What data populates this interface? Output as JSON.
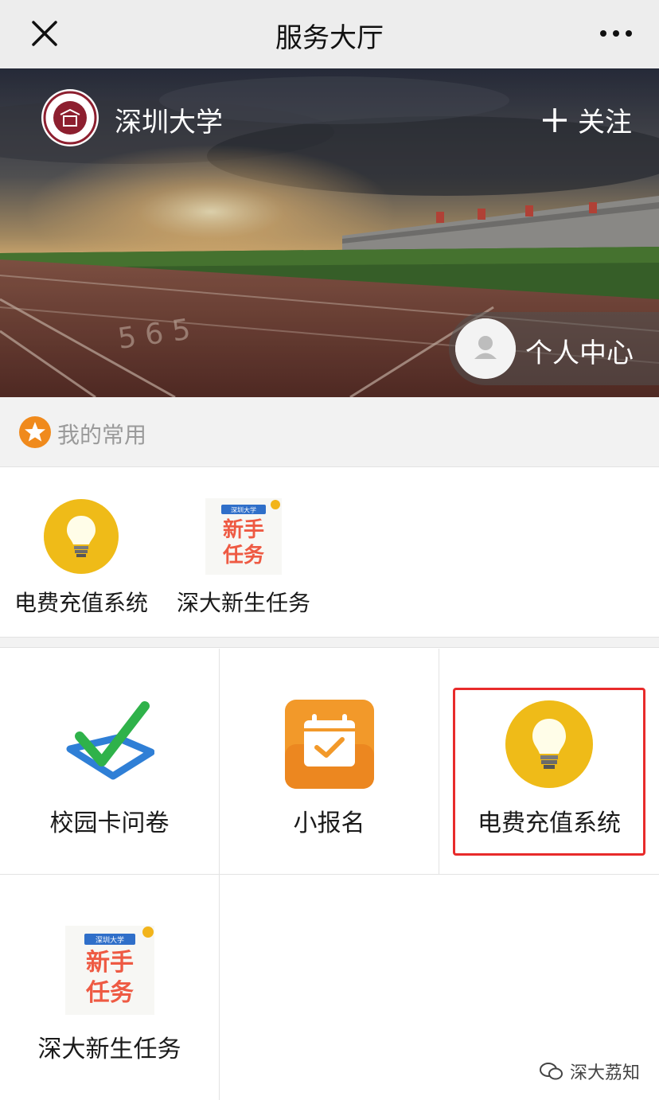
{
  "navbar": {
    "title": "服务大厅"
  },
  "banner": {
    "school_name": "深圳大学",
    "follow_label": "关注",
    "personal_center_label": "个人中心"
  },
  "favorites": {
    "title": "我的常用",
    "items": [
      {
        "label": "电费充值系统",
        "icon": "lightbulb-icon"
      },
      {
        "label": "深大新生任务",
        "icon": "newbie-task-icon"
      }
    ]
  },
  "grid": {
    "items": [
      {
        "label": "校园卡问卷",
        "icon": "checkmark-icon"
      },
      {
        "label": "小报名",
        "icon": "calendar-check-icon"
      },
      {
        "label": "电费充值系统",
        "icon": "lightbulb-icon"
      },
      {
        "label": "深大新生任务",
        "icon": "newbie-task-icon"
      }
    ]
  },
  "task_icon_text": {
    "top": "深圳大学",
    "line1": "新手",
    "line2": "任务"
  },
  "watermark": {
    "text": "深大荔知"
  },
  "colors": {
    "accent_orange": "#f08a1c",
    "highlight_red": "#e82b2b",
    "bulb_yellow": "#f2c21b"
  }
}
